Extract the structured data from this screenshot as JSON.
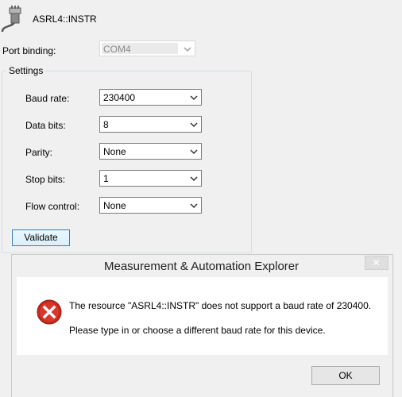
{
  "header": {
    "title": "ASRL4::INSTR",
    "icon": "serial-port-connector-icon"
  },
  "port_binding": {
    "label": "Port binding:",
    "value": "COM4"
  },
  "settings": {
    "legend": "Settings",
    "fields": [
      {
        "label": "Baud rate:",
        "value": "230400"
      },
      {
        "label": "Data bits:",
        "value": "8"
      },
      {
        "label": "Parity:",
        "value": "None"
      },
      {
        "label": "Stop bits:",
        "value": "1"
      },
      {
        "label": "Flow control:",
        "value": "None"
      }
    ],
    "validate_label": "Validate"
  },
  "dialog": {
    "title": "Measurement & Automation Explorer",
    "close_symbol": "✕",
    "icon": "error-icon",
    "message_line1": "The resource \"ASRL4::INSTR\" does not support a baud rate of 230400.",
    "message_line2": "Please type in or choose a different baud rate for this device.",
    "ok_label": "OK"
  },
  "colors": {
    "error_red": "#c42b1c",
    "window_bg": "#f0f0f0",
    "button_accent": "#3c7fb1"
  }
}
